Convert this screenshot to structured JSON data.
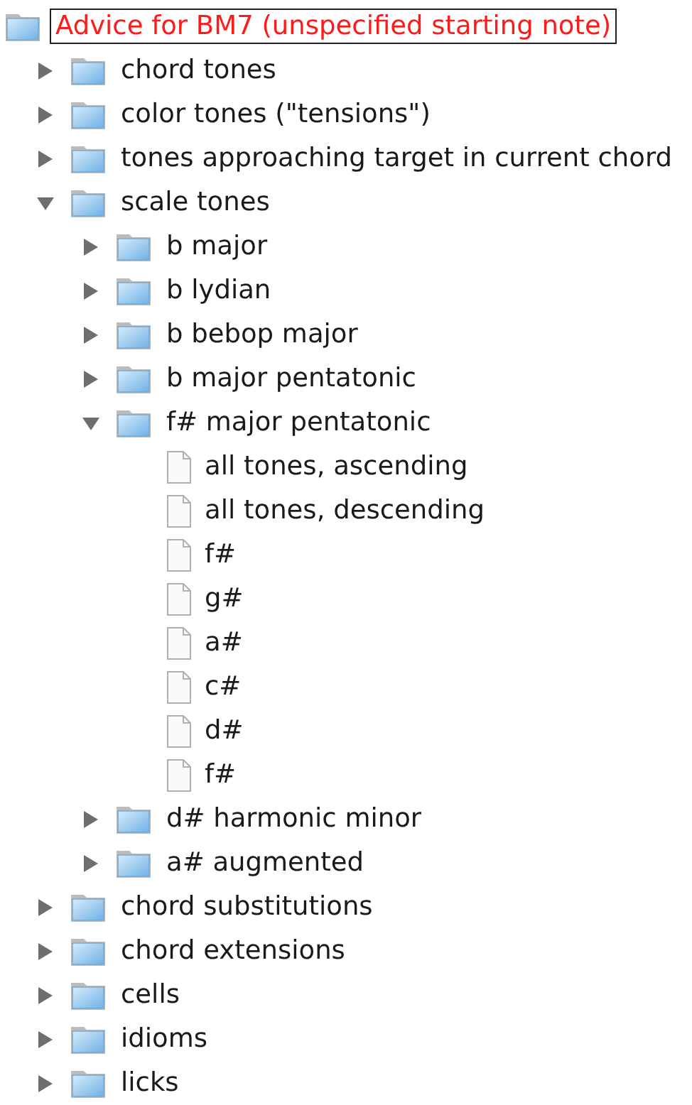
{
  "tree": {
    "label": "Advice for BM7 (unspecified starting note)",
    "kind": "folder",
    "selected": true,
    "children": [
      {
        "label": "chord tones",
        "kind": "folder",
        "expanded": false,
        "selected": false
      },
      {
        "label": "color tones (\"tensions\")",
        "kind": "folder",
        "expanded": false,
        "selected": false
      },
      {
        "label": "tones approaching target in current chord",
        "kind": "folder",
        "expanded": false,
        "selected": false
      },
      {
        "label": "scale tones",
        "kind": "folder",
        "expanded": true,
        "selected": false,
        "children": [
          {
            "label": "b major",
            "kind": "folder",
            "expanded": false,
            "selected": false
          },
          {
            "label": "b lydian",
            "kind": "folder",
            "expanded": false,
            "selected": false
          },
          {
            "label": "b bebop major",
            "kind": "folder",
            "expanded": false,
            "selected": false
          },
          {
            "label": "b major pentatonic",
            "kind": "folder",
            "expanded": false,
            "selected": false
          },
          {
            "label": "f# major pentatonic",
            "kind": "folder",
            "expanded": true,
            "selected": false,
            "children": [
              {
                "label": "all tones, ascending",
                "kind": "file",
                "selected": false
              },
              {
                "label": "all tones, descending",
                "kind": "file",
                "selected": false
              },
              {
                "label": "f#",
                "kind": "file",
                "selected": false
              },
              {
                "label": "g#",
                "kind": "file",
                "selected": false
              },
              {
                "label": "a#",
                "kind": "file",
                "selected": false
              },
              {
                "label": "c#",
                "kind": "file",
                "selected": false
              },
              {
                "label": "d#",
                "kind": "file",
                "selected": false
              },
              {
                "label": "f#",
                "kind": "file",
                "selected": false
              }
            ]
          },
          {
            "label": "d# harmonic minor",
            "kind": "folder",
            "expanded": false,
            "selected": false
          },
          {
            "label": "a# augmented",
            "kind": "folder",
            "expanded": false,
            "selected": false
          }
        ]
      },
      {
        "label": "chord substitutions",
        "kind": "folder",
        "expanded": false,
        "selected": false
      },
      {
        "label": "chord extensions",
        "kind": "folder",
        "expanded": false,
        "selected": false
      },
      {
        "label": "cells",
        "kind": "folder",
        "expanded": false,
        "selected": false
      },
      {
        "label": "idioms",
        "kind": "folder",
        "expanded": false,
        "selected": false
      },
      {
        "label": "licks",
        "kind": "folder",
        "expanded": false,
        "selected": false
      }
    ]
  }
}
